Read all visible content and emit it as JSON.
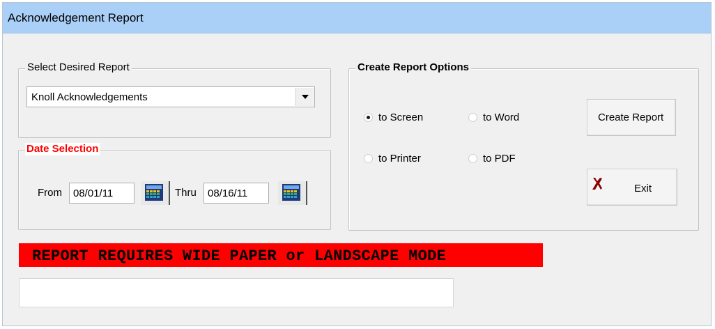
{
  "window": {
    "title": "Acknowledgement Report"
  },
  "report_select": {
    "legend": "Select Desired Report",
    "selected": "Knoll Acknowledgements"
  },
  "date_selection": {
    "legend": "Date Selection",
    "from_label": "From",
    "from_value": "08/01/11",
    "thru_label": "Thru",
    "thru_value": "08/16/11"
  },
  "options": {
    "legend": "Create Report Options",
    "radios": [
      {
        "label": "to Screen",
        "selected": true
      },
      {
        "label": "to Word",
        "selected": false
      },
      {
        "label": "to Printer",
        "selected": false
      },
      {
        "label": "to PDF",
        "selected": false
      }
    ],
    "create_label": "Create Report",
    "exit_label": "Exit"
  },
  "banner": {
    "text": "REPORT REQUIRES WIDE PAPER or LANDSCAPE MODE",
    "color": "#ff0000"
  },
  "status": {
    "text": ""
  },
  "colors": {
    "titlebar": "#aad0f8",
    "legend_red": "#ff0000"
  }
}
